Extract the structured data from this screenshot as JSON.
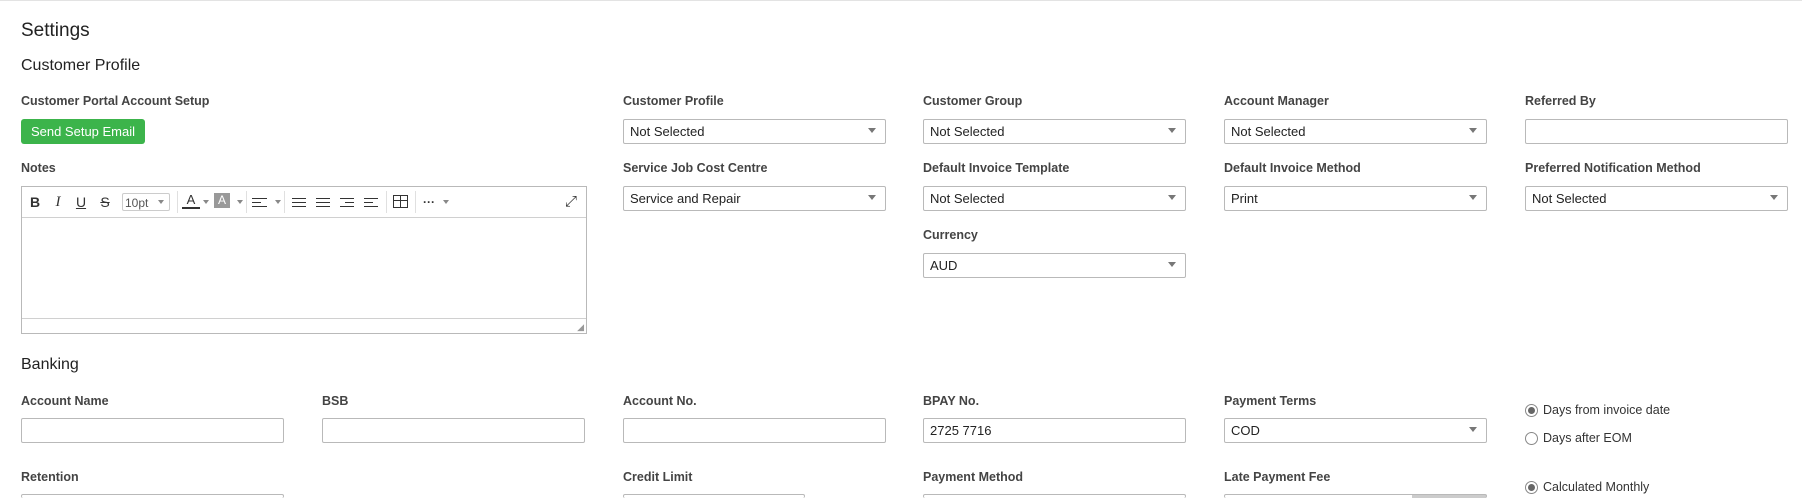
{
  "page": {
    "title": "Settings"
  },
  "customer_profile": {
    "heading": "Customer Profile",
    "portal_label": "Customer Portal Account Setup",
    "send_email_button": "Send Setup Email",
    "notes_label": "Notes",
    "editor": {
      "font_size": "10pt"
    },
    "fields": {
      "customer_profile": {
        "label": "Customer Profile",
        "value": "Not Selected"
      },
      "customer_group": {
        "label": "Customer Group",
        "value": "Not Selected"
      },
      "account_manager": {
        "label": "Account Manager",
        "value": "Not Selected"
      },
      "referred_by": {
        "label": "Referred By",
        "value": ""
      },
      "service_job_cost_centre": {
        "label": "Service Job Cost Centre",
        "value": "Service and Repair"
      },
      "default_invoice_template": {
        "label": "Default Invoice Template",
        "value": "Not Selected"
      },
      "default_invoice_method": {
        "label": "Default Invoice Method",
        "value": "Print"
      },
      "preferred_notification_method": {
        "label": "Preferred Notification Method",
        "value": "Not Selected"
      },
      "currency": {
        "label": "Currency",
        "value": "AUD"
      }
    }
  },
  "banking": {
    "heading": "Banking",
    "fields": {
      "account_name": {
        "label": "Account Name",
        "value": ""
      },
      "bsb": {
        "label": "BSB",
        "value": ""
      },
      "account_no": {
        "label": "Account No.",
        "value": ""
      },
      "bpay_no": {
        "label": "BPAY No.",
        "value": "2725 7716"
      },
      "payment_terms": {
        "label": "Payment Terms",
        "value": "COD"
      },
      "retention": {
        "label": "Retention"
      },
      "credit_limit": {
        "label": "Credit Limit"
      },
      "payment_method": {
        "label": "Payment Method"
      },
      "late_payment_fee": {
        "label": "Late Payment Fee"
      }
    },
    "terms_options": [
      {
        "label": "Days from invoice date",
        "selected": true
      },
      {
        "label": "Days after EOM",
        "selected": false
      }
    ],
    "fee_options": [
      {
        "label": "Calculated Monthly",
        "selected": true
      }
    ]
  }
}
